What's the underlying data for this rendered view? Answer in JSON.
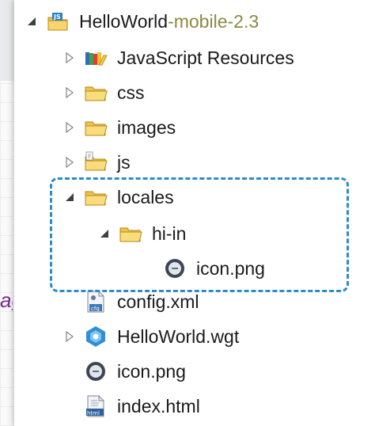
{
  "background": {
    "text_fragment": "ag"
  },
  "tree": {
    "project": {
      "name": "HelloWorld",
      "separator": " - ",
      "profile": "mobile-2.3"
    },
    "items": [
      {
        "label": "JavaScript Resources",
        "icon": "javascript-resources-icon",
        "state": "collapsed"
      },
      {
        "label": "css",
        "icon": "folder-icon",
        "state": "collapsed"
      },
      {
        "label": "images",
        "icon": "folder-icon",
        "state": "collapsed"
      },
      {
        "label": "js",
        "icon": "js-folder-icon",
        "state": "collapsed"
      },
      {
        "label": "locales",
        "icon": "folder-icon",
        "state": "expanded"
      },
      {
        "label": "hi-in",
        "icon": "folder-icon",
        "state": "expanded"
      },
      {
        "label": "icon.png",
        "icon": "image-file-icon",
        "state": "leaf"
      },
      {
        "label": "config.xml",
        "icon": "config-xml-icon",
        "state": "leaf"
      },
      {
        "label": "HelloWorld.wgt",
        "icon": "widget-package-icon",
        "state": "collapsed"
      },
      {
        "label": "icon.png",
        "icon": "image-file-icon",
        "state": "leaf"
      },
      {
        "label": "index.html",
        "icon": "html-file-icon",
        "state": "leaf"
      }
    ]
  },
  "colors": {
    "highlight_border": "#2e8bc9",
    "folder": "#f2c94c",
    "profile_text": "#8a8a40"
  }
}
